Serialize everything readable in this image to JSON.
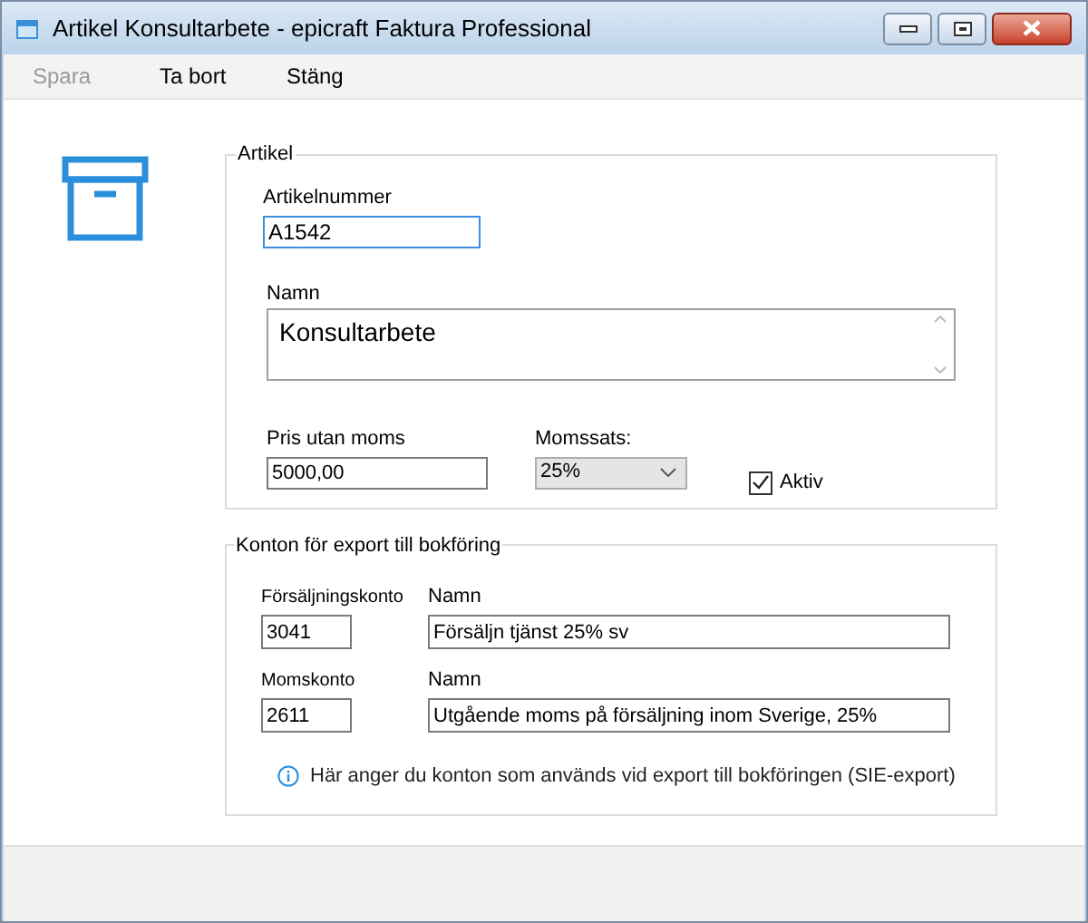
{
  "window": {
    "title": "Artikel Konsultarbete - epicraft Faktura Professional"
  },
  "toolbar": [
    {
      "label": "Spara",
      "disabled": true
    },
    {
      "label": "Ta bort",
      "disabled": false
    },
    {
      "label": "Stäng",
      "disabled": false
    }
  ],
  "article": {
    "legend": "Artikel",
    "number_label": "Artikelnummer",
    "number_value": "A1542",
    "name_label": "Namn",
    "name_value": "Konsultarbete",
    "price_label": "Pris utan moms",
    "price_value": "5000,00",
    "vat_label": "Momssats:",
    "vat_value": "25%",
    "active_label": "Aktiv",
    "active_checked": true
  },
  "accounts": {
    "legend": "Konton för export till bokföring",
    "rows": [
      {
        "account_label": "Försäljningskonto",
        "account_value": "3041",
        "name_label": "Namn",
        "name_value": "Försäljn tjänst 25% sv"
      },
      {
        "account_label": "Momskonto",
        "account_value": "2611",
        "name_label": "Namn",
        "name_value": "Utgående moms på försäljning inom Sverige, 25%"
      }
    ],
    "info": "Här anger du konton som används vid export till bokföringen (SIE-export)"
  }
}
